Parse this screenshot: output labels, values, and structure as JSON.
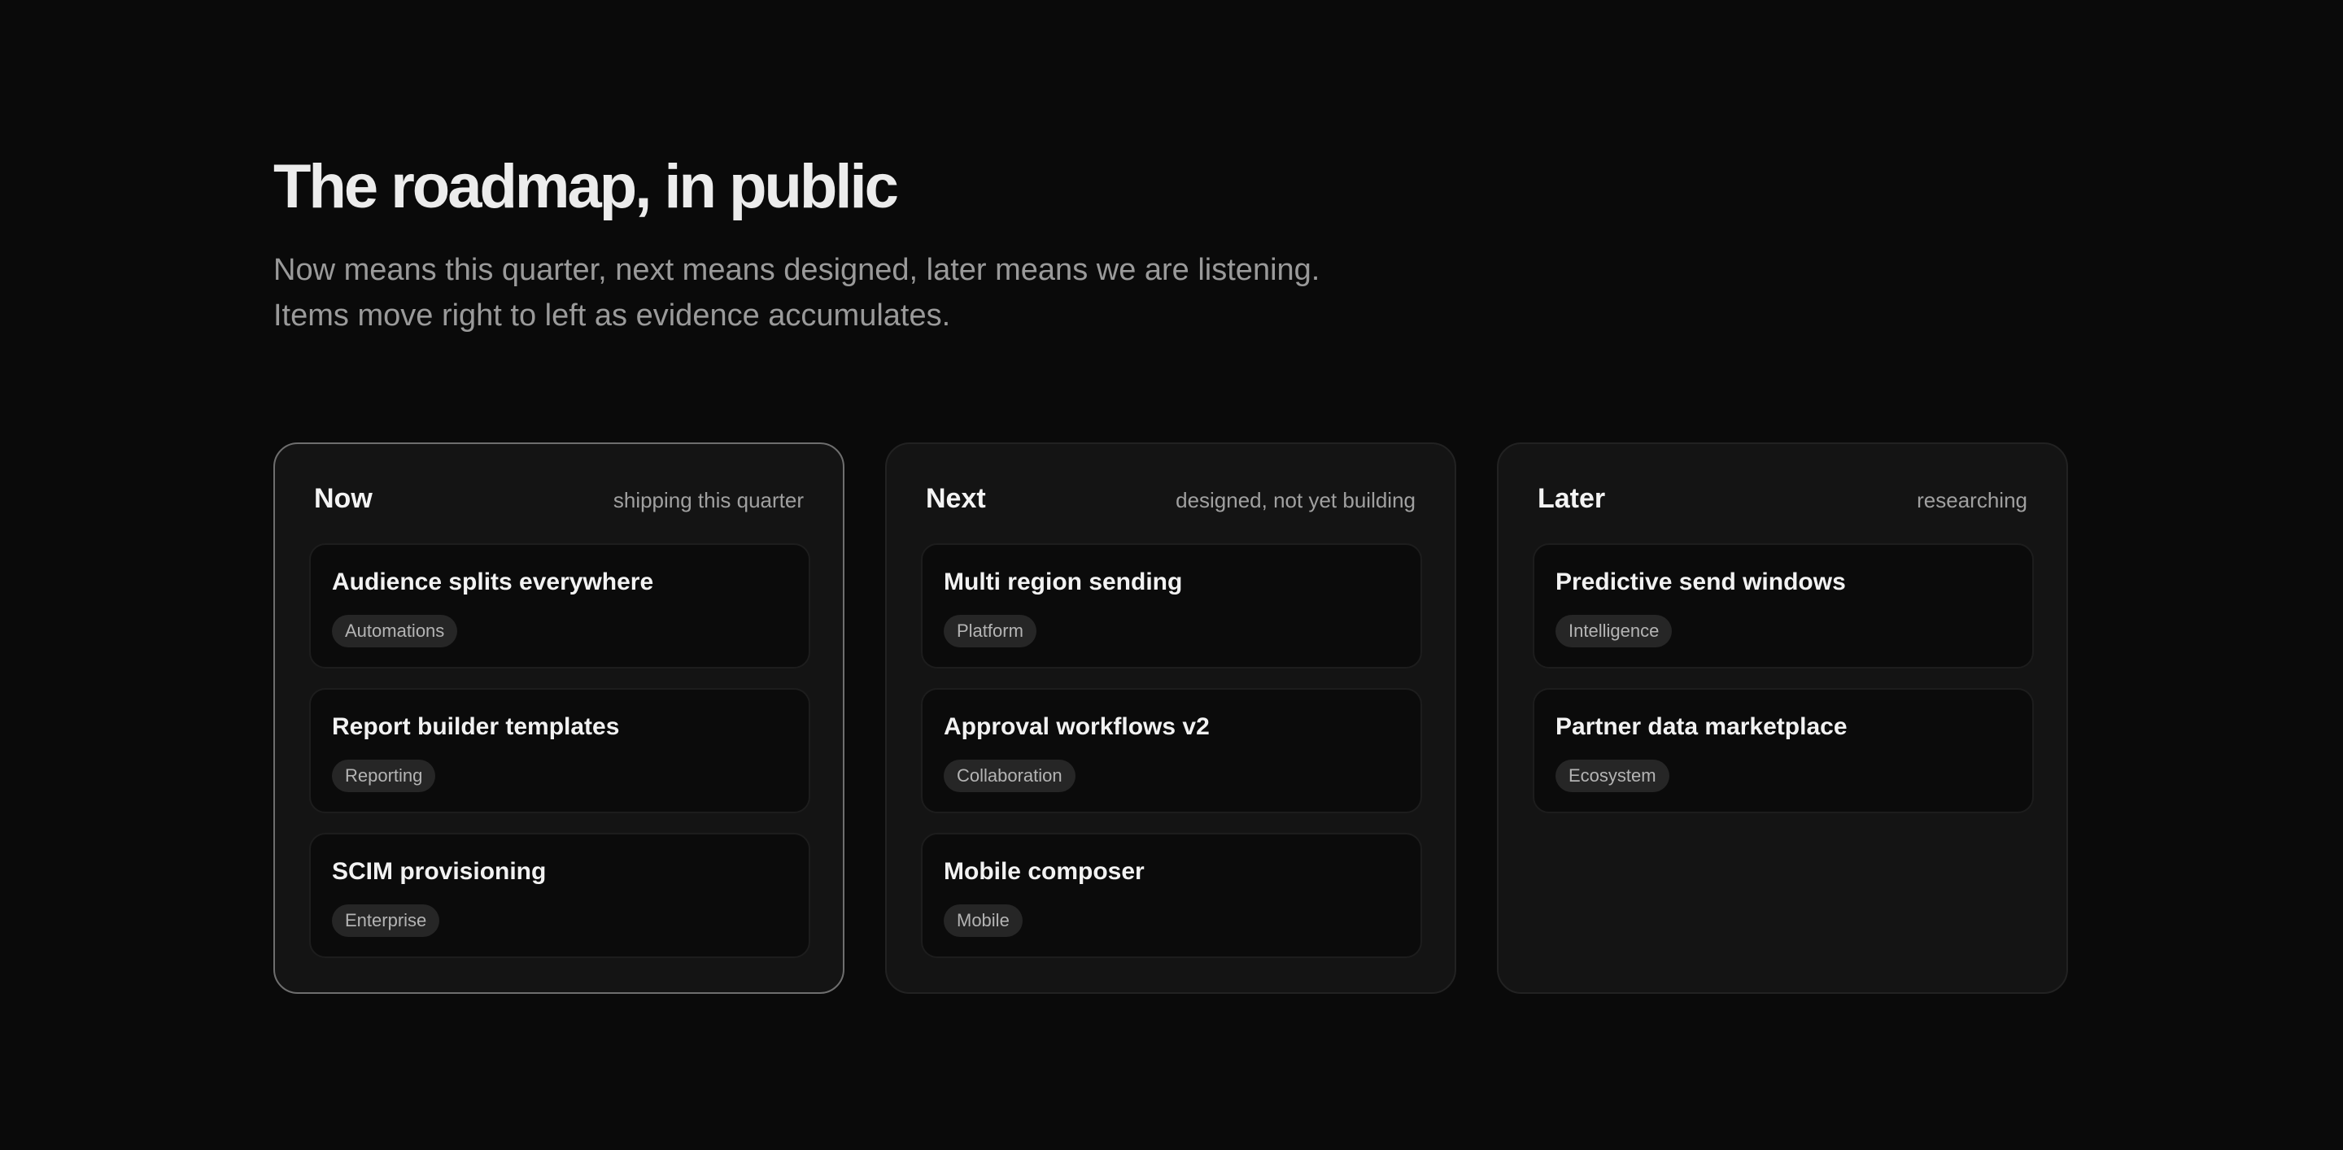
{
  "hero": {
    "title": "The roadmap, in public",
    "subtitle_line1": "Now means this quarter, next means designed, later means we are listening.",
    "subtitle_line2": "Items move right to left as evidence accumulates."
  },
  "columns": [
    {
      "title": "Now",
      "caption": "shipping this quarter",
      "items": [
        {
          "title": "Audience splits everywhere",
          "tag": "Automations"
        },
        {
          "title": "Report builder templates",
          "tag": "Reporting"
        },
        {
          "title": "SCIM provisioning",
          "tag": "Enterprise"
        }
      ]
    },
    {
      "title": "Next",
      "caption": "designed, not yet building",
      "items": [
        {
          "title": "Multi region sending",
          "tag": "Platform"
        },
        {
          "title": "Approval workflows v2",
          "tag": "Collaboration"
        },
        {
          "title": "Mobile composer",
          "tag": "Mobile"
        }
      ]
    },
    {
      "title": "Later",
      "caption": "researching",
      "items": [
        {
          "title": "Predictive send windows",
          "tag": "Intelligence"
        },
        {
          "title": "Partner data marketplace",
          "tag": "Ecosystem"
        }
      ]
    }
  ],
  "colors": {
    "background": "#0a0a0a",
    "column_background": "#141414",
    "card_background": "#0b0b0b",
    "tag_background": "#262626",
    "active_border": "#6e6e6e"
  }
}
